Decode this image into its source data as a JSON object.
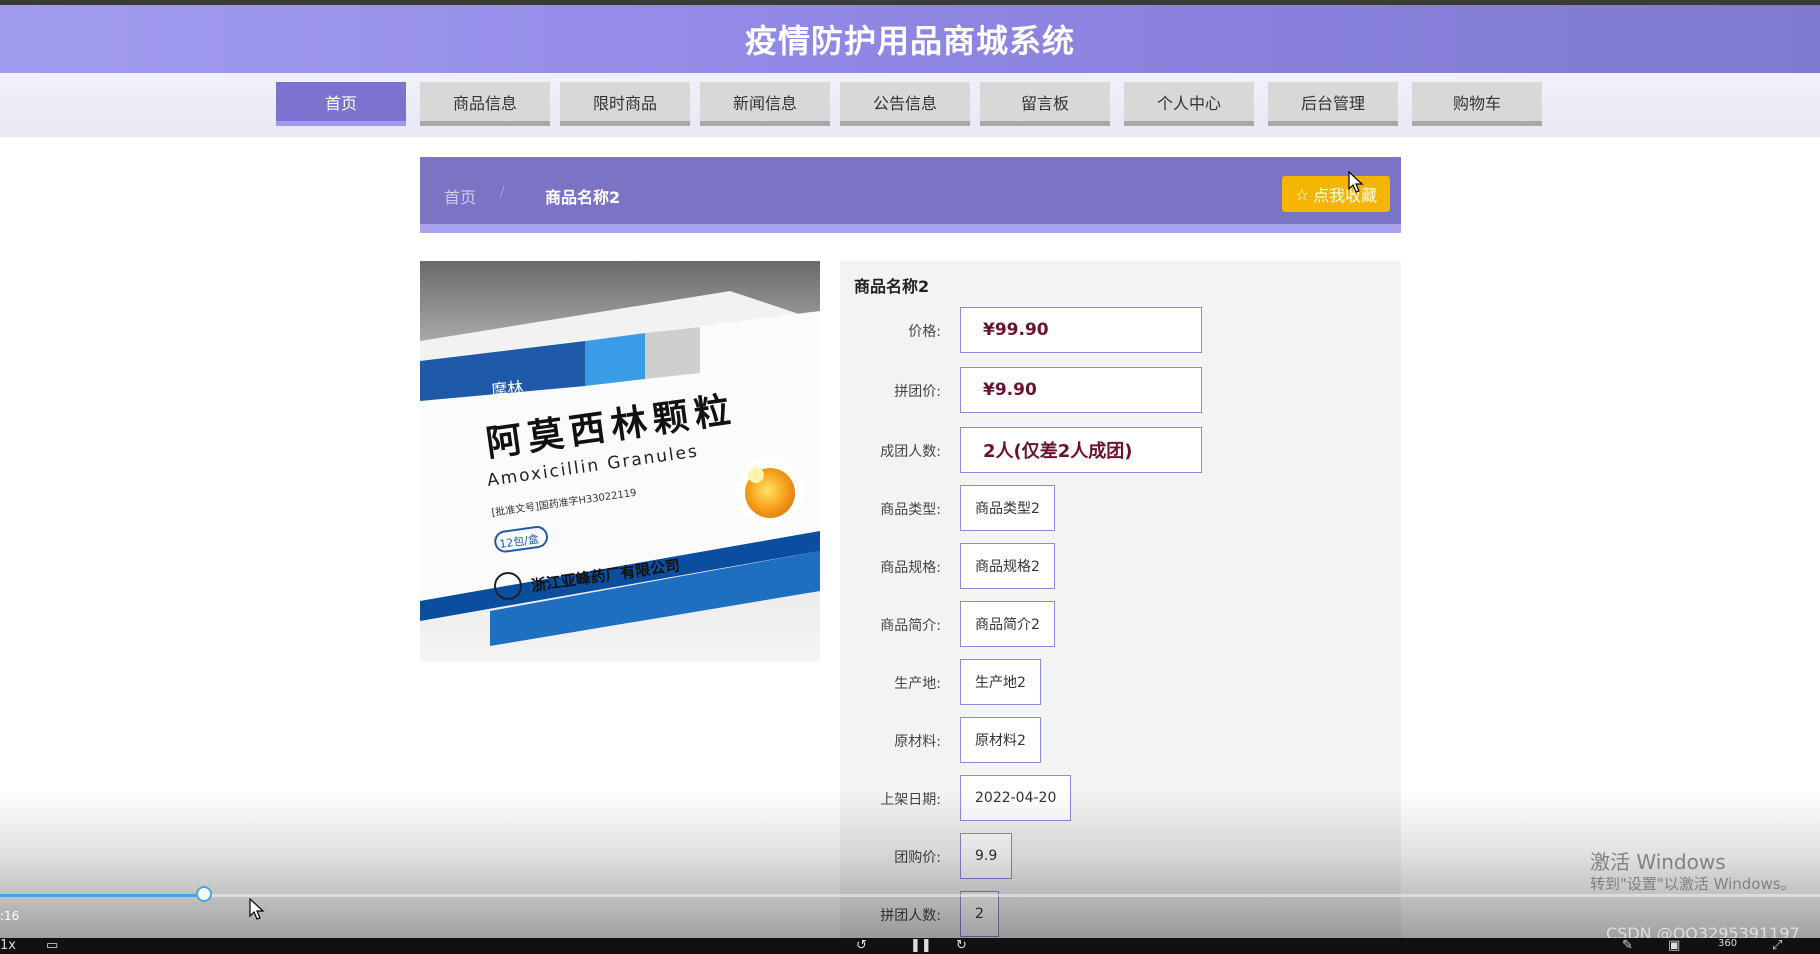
{
  "site": {
    "title": "疫情防护用品商城系统"
  },
  "nav": {
    "items": [
      {
        "label": "首页",
        "active": true
      },
      {
        "label": "商品信息",
        "active": false
      },
      {
        "label": "限时商品",
        "active": false
      },
      {
        "label": "新闻信息",
        "active": false
      },
      {
        "label": "公告信息",
        "active": false
      },
      {
        "label": "留言板",
        "active": false
      },
      {
        "label": "个人中心",
        "active": false
      },
      {
        "label": "后台管理",
        "active": false
      },
      {
        "label": "购物车",
        "active": false
      }
    ]
  },
  "breadcrumb": {
    "home": "首页",
    "separator": "/",
    "current": "商品名称2"
  },
  "favorite": {
    "label": "点我收藏",
    "icon": "star-outline-icon"
  },
  "product": {
    "name": "商品名称2",
    "image_text": {
      "brand": "摩林",
      "name_cn": "阿莫西林颗粒",
      "name_en": "Amoxicillin Granules",
      "approval": "[批准文号]国药准字H33022119",
      "pack": "12包/盒",
      "maker": "浙江亚峰药厂有限公司"
    },
    "fields": [
      {
        "label": "价格:",
        "value": "¥99.90"
      },
      {
        "label": "拼团价:",
        "value": "¥9.90"
      },
      {
        "label": "成团人数:",
        "value": "2人(仅差2人成团)"
      },
      {
        "label": "商品类型:",
        "value": "商品类型2"
      },
      {
        "label": "商品规格:",
        "value": "商品规格2"
      },
      {
        "label": "商品简介:",
        "value": "商品简介2"
      },
      {
        "label": "生产地:",
        "value": "生产地2"
      },
      {
        "label": "原材料:",
        "value": "原材料2"
      },
      {
        "label": "上架日期:",
        "value": "2022-04-20"
      },
      {
        "label": "团购价:",
        "value": "9.9"
      },
      {
        "label": "拼团人数:",
        "value": "2"
      }
    ]
  },
  "player": {
    "time": ":16",
    "speed": "1x",
    "progress_fraction": 0.11,
    "quality": "360"
  },
  "overlay": {
    "windows_line1": "激活 Windows",
    "windows_line2": "转到\"设置\"以激活 Windows。",
    "csdn": "CSDN @QQ3295391197"
  },
  "colors": {
    "header": "#8f86e4",
    "accent": "#7b73cf",
    "favorite": "#f5b400",
    "price": "#6b1230"
  }
}
